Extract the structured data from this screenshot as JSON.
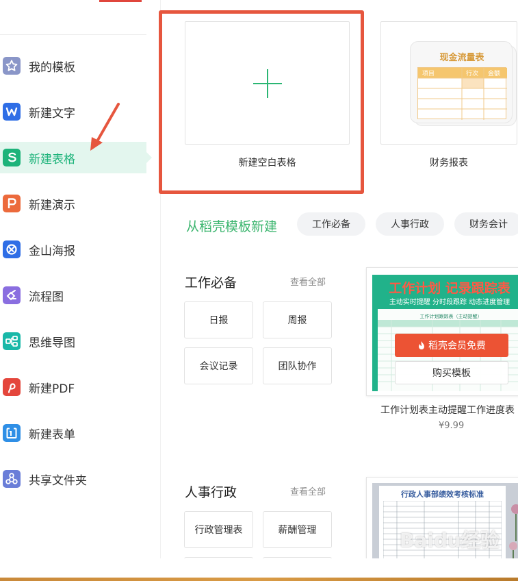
{
  "sidebar": {
    "items": [
      {
        "label": "我的模板",
        "icon": "star-icon",
        "color": "#8a96c8",
        "active": false
      },
      {
        "label": "新建文字",
        "icon": "writer-w-icon",
        "color": "#2f6ee6",
        "active": false
      },
      {
        "label": "新建表格",
        "icon": "spreadsheet-s-icon",
        "color": "#1db37a",
        "active": true
      },
      {
        "label": "新建演示",
        "icon": "presentation-p-icon",
        "color": "#ec6a3c",
        "active": false
      },
      {
        "label": "金山海报",
        "icon": "poster-icon",
        "color": "#2f6ee6",
        "active": false
      },
      {
        "label": "流程图",
        "icon": "flowchart-icon",
        "color": "#8a6ee0",
        "active": false
      },
      {
        "label": "思维导图",
        "icon": "mindmap-icon",
        "color": "#19b8a8",
        "active": false
      },
      {
        "label": "新建PDF",
        "icon": "pdf-icon",
        "color": "#e4463c",
        "active": false
      },
      {
        "label": "新建表单",
        "icon": "form-icon",
        "color": "#2f8fe6",
        "active": false
      },
      {
        "label": "共享文件夹",
        "icon": "shared-folder-icon",
        "color": "#6a7ed8",
        "active": false
      }
    ]
  },
  "cards": {
    "blank": {
      "label": "新建空白表格"
    },
    "finance": {
      "label": "财务报表",
      "thumb_title": "现金流量表",
      "thumb_headers": [
        "项目",
        "行次",
        "金额"
      ]
    }
  },
  "templates_header": {
    "title": "从稻壳模板新建",
    "pills": [
      "工作必备",
      "人事行政",
      "财务会计"
    ]
  },
  "section_work": {
    "title": "工作必备",
    "view_all": "查看全部",
    "tags": [
      "日报",
      "周报",
      "会议记录",
      "团队协作"
    ],
    "template": {
      "banner_title": "工作计划 记录跟踪表",
      "banner_subtitle": "主动实时提醒  分时段跟踪  动态进度管理",
      "sheet_caption": "工作计划跟踪表（主动提醒）",
      "vip_label": "稻壳会员免费",
      "buy_label": "购买模板",
      "title": "工作计划表主动提醒工作进度表",
      "price": "¥9.99"
    }
  },
  "section_hr": {
    "title": "人事行政",
    "view_all": "查看全部",
    "tags": [
      "行政管理表",
      "薪酬管理"
    ],
    "template": {
      "doc_title": "行政人事部绩效考核标准"
    }
  },
  "annotation": {
    "arrow_color": "#e6563e",
    "frame_color": "#e6563e"
  },
  "watermark": "Baidu经验"
}
